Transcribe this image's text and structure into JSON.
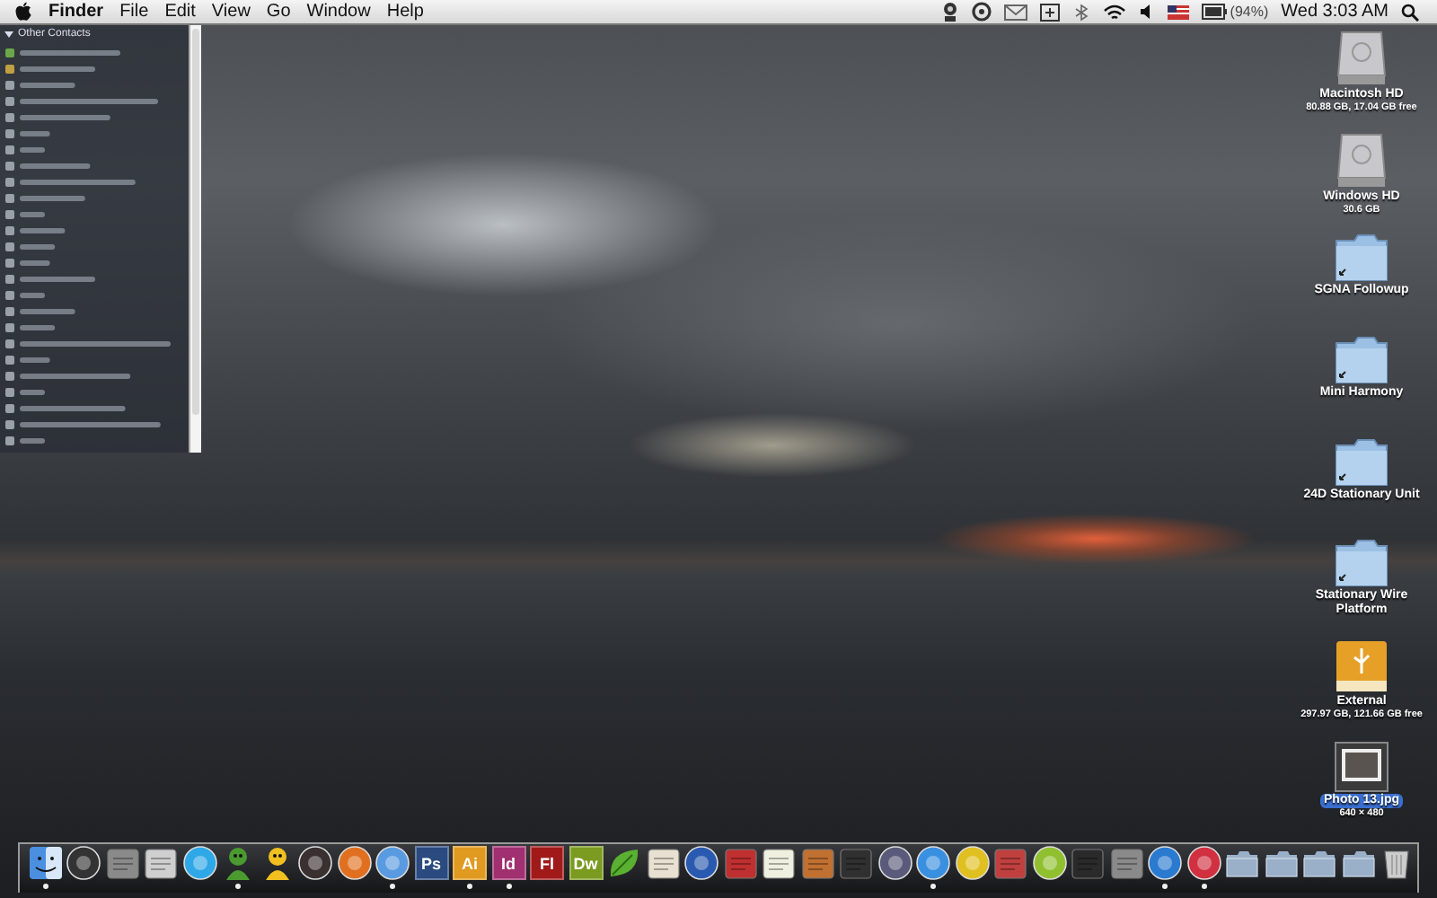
{
  "menu_bar": {
    "app_name": "Finder",
    "menus": [
      "File",
      "Edit",
      "View",
      "Go",
      "Window",
      "Help"
    ],
    "battery_text": "(94%)",
    "clock": "Wed 3:03 AM"
  },
  "contacts_panel": {
    "header": "Other Contacts",
    "expanded": true
  },
  "desktop_icons": [
    {
      "kind": "disk",
      "label": "Macintosh HD",
      "info": "80.88 GB, 17.04 GB free",
      "selected": false
    },
    {
      "kind": "disk",
      "label": "Windows HD",
      "info": "30.6 GB",
      "selected": false
    },
    {
      "kind": "folder",
      "label": "SGNA Followup",
      "selected": false
    },
    {
      "kind": "folder",
      "label": "Mini Harmony",
      "selected": false
    },
    {
      "kind": "folder",
      "label": "24D Stationary Unit",
      "selected": false
    },
    {
      "kind": "folder",
      "label": "Stationary Wire Platform",
      "selected": false
    },
    {
      "kind": "usb",
      "label": "External",
      "info": "297.97 GB, 121.66 GB free",
      "selected": false
    },
    {
      "kind": "photo",
      "label": "Photo 13.jpg",
      "info": "640 × 480",
      "selected": true
    }
  ],
  "dock": [
    {
      "kind": "finder",
      "color": "#4a8fe0",
      "running": true
    },
    {
      "kind": "circle",
      "color": "#333333",
      "running": false
    },
    {
      "kind": "tile",
      "color": "#8a8a8a",
      "running": false
    },
    {
      "kind": "tile",
      "color": "#cfcfcf",
      "running": false
    },
    {
      "kind": "circle",
      "color": "#2fa8e8",
      "running": false
    },
    {
      "kind": "figure",
      "color": "#4a9a30",
      "running": true
    },
    {
      "kind": "figure",
      "color": "#f0c020",
      "running": false
    },
    {
      "kind": "circle",
      "color": "#3a3030",
      "running": false
    },
    {
      "kind": "circle",
      "color": "#e07020",
      "running": false
    },
    {
      "kind": "circle",
      "color": "#5a9ae0",
      "running": true
    },
    {
      "kind": "text",
      "label": "Ps",
      "color": "#2a4a80",
      "running": false
    },
    {
      "kind": "text",
      "label": "Ai",
      "color": "#e09a20",
      "running": true
    },
    {
      "kind": "text",
      "label": "Id",
      "color": "#a03070",
      "running": true
    },
    {
      "kind": "text",
      "label": "Fl",
      "color": "#a01a1a",
      "running": false
    },
    {
      "kind": "text",
      "label": "Dw",
      "color": "#7a9a20",
      "running": false
    },
    {
      "kind": "leaf",
      "color": "#5ab030",
      "running": false
    },
    {
      "kind": "tile",
      "color": "#e8e0d0",
      "running": false
    },
    {
      "kind": "circle",
      "color": "#2a5ab0",
      "running": false
    },
    {
      "kind": "tile",
      "color": "#c03030",
      "running": false
    },
    {
      "kind": "tile",
      "color": "#f0f0e0",
      "running": false
    },
    {
      "kind": "tile",
      "color": "#c07030",
      "running": false
    },
    {
      "kind": "tile",
      "color": "#303030",
      "running": false
    },
    {
      "kind": "circle",
      "color": "#5a5a7a",
      "running": false
    },
    {
      "kind": "circle",
      "color": "#3a90e0",
      "running": true
    },
    {
      "kind": "circle",
      "color": "#e0c020",
      "running": false
    },
    {
      "kind": "tile",
      "color": "#c04040",
      "running": false
    },
    {
      "kind": "circle",
      "color": "#90c030",
      "running": false
    },
    {
      "kind": "tile",
      "color": "#2a2a2a",
      "running": false
    },
    {
      "kind": "tile",
      "color": "#8a8a8a",
      "running": false
    },
    {
      "kind": "circle",
      "color": "#2a7ad0",
      "running": true
    },
    {
      "kind": "circle",
      "color": "#d03040",
      "running": true
    },
    {
      "kind": "folder",
      "color": "#9ab0c8",
      "running": false
    },
    {
      "kind": "folder",
      "color": "#9ab0c8",
      "running": false
    },
    {
      "kind": "folder",
      "color": "#9ab0c8",
      "running": false
    },
    {
      "kind": "folder",
      "color": "#9ab0c8",
      "running": false
    },
    {
      "kind": "trash",
      "color": "#cccccc",
      "running": false
    }
  ]
}
